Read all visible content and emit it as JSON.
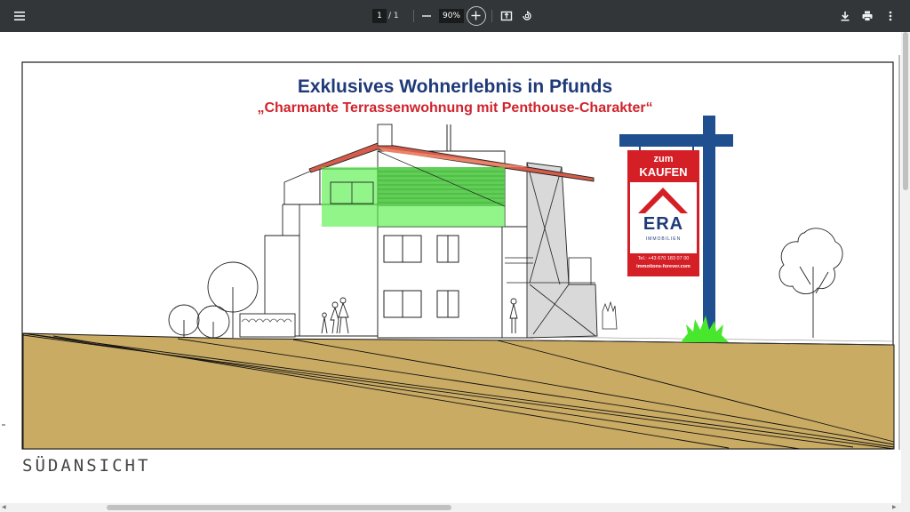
{
  "toolbar": {
    "menu_icon": "menu-icon",
    "page_current": "1",
    "page_separator": "/ 1",
    "zoom": "90%",
    "zoom_out_icon": "minus-icon",
    "zoom_in_icon": "plus-icon",
    "fit_icon": "fit-page-icon",
    "rotate_icon": "rotate-icon",
    "download_icon": "download-icon",
    "print_icon": "print-icon",
    "more_icon": "more-vert-icon"
  },
  "document": {
    "headline": "Exklusives Wohnerlebnis in Pfunds",
    "subheadline": "„Charmante Terrassenwohnung mit Penthouse-Charakter“",
    "view_label": "SÜDANSICHT",
    "sign": {
      "zum": "zum",
      "kaufen": "KAUFEN",
      "brand": "ERA",
      "brand_sub": "IMMOBILIEN",
      "phone": "Tel.: +43 670 183 07 00",
      "web": "immotions-forever.com"
    }
  },
  "colors": {
    "toolbar_bg": "#323639",
    "headline": "#1f3a78",
    "subheadline": "#d0232c",
    "ground": "#c9ab64",
    "roof": "#c0392b",
    "highlight_green": "#58f04a",
    "sign_post": "#1f4f8f",
    "sign_red": "#d51f26"
  }
}
